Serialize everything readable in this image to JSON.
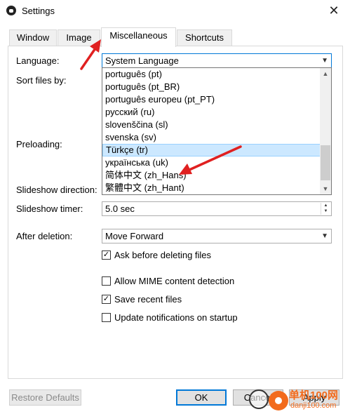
{
  "window": {
    "title": "Settings",
    "close_glyph": "✕",
    "icon": "app-logo-icon"
  },
  "tabs": [
    {
      "label": "Window",
      "active": false
    },
    {
      "label": "Image",
      "active": false
    },
    {
      "label": "Miscellaneous",
      "active": true
    },
    {
      "label": "Shortcuts",
      "active": false
    }
  ],
  "labels": {
    "language": "Language:",
    "sort_files_by": "Sort files by:",
    "preloading": "Preloading:",
    "slideshow_direction": "Slideshow direction:",
    "slideshow_timer": "Slideshow timer:",
    "after_deletion": "After deletion:"
  },
  "language_select": {
    "value": "System Language",
    "options": [
      {
        "label": "português (pt)",
        "selected": false
      },
      {
        "label": "português (pt_BR)",
        "selected": false
      },
      {
        "label": "português europeu (pt_PT)",
        "selected": false
      },
      {
        "label": "русский (ru)",
        "selected": false
      },
      {
        "label": "slovenščina (sl)",
        "selected": false
      },
      {
        "label": "svenska (sv)",
        "selected": false
      },
      {
        "label": "Türkçe (tr)",
        "selected": true
      },
      {
        "label": "українська (uk)",
        "selected": false
      },
      {
        "label": "简体中文 (zh_Hans)",
        "selected": false
      },
      {
        "label": "繁體中文 (zh_Hant)",
        "selected": false
      }
    ]
  },
  "slideshow_timer": {
    "value": "5.0 sec"
  },
  "after_deletion": {
    "value": "Move Forward"
  },
  "checkboxes": {
    "ask_before_deleting": {
      "label": "Ask before deleting files",
      "checked": true
    },
    "allow_mime": {
      "label": "Allow MIME content detection",
      "checked": false
    },
    "save_recent": {
      "label": "Save recent files",
      "checked": true
    },
    "update_notifications": {
      "label": "Update notifications on startup",
      "checked": false
    }
  },
  "buttons": {
    "restore_defaults": "Restore Defaults",
    "ok": "OK",
    "cancel": "Cancel",
    "apply": "Apply"
  },
  "watermark": {
    "line1": "单机100网",
    "line2": "danji100.com"
  },
  "colors": {
    "accent": "#0078d7",
    "selection": "#cce8ff",
    "arrow": "#e02020",
    "watermark": "#f26b1d"
  }
}
